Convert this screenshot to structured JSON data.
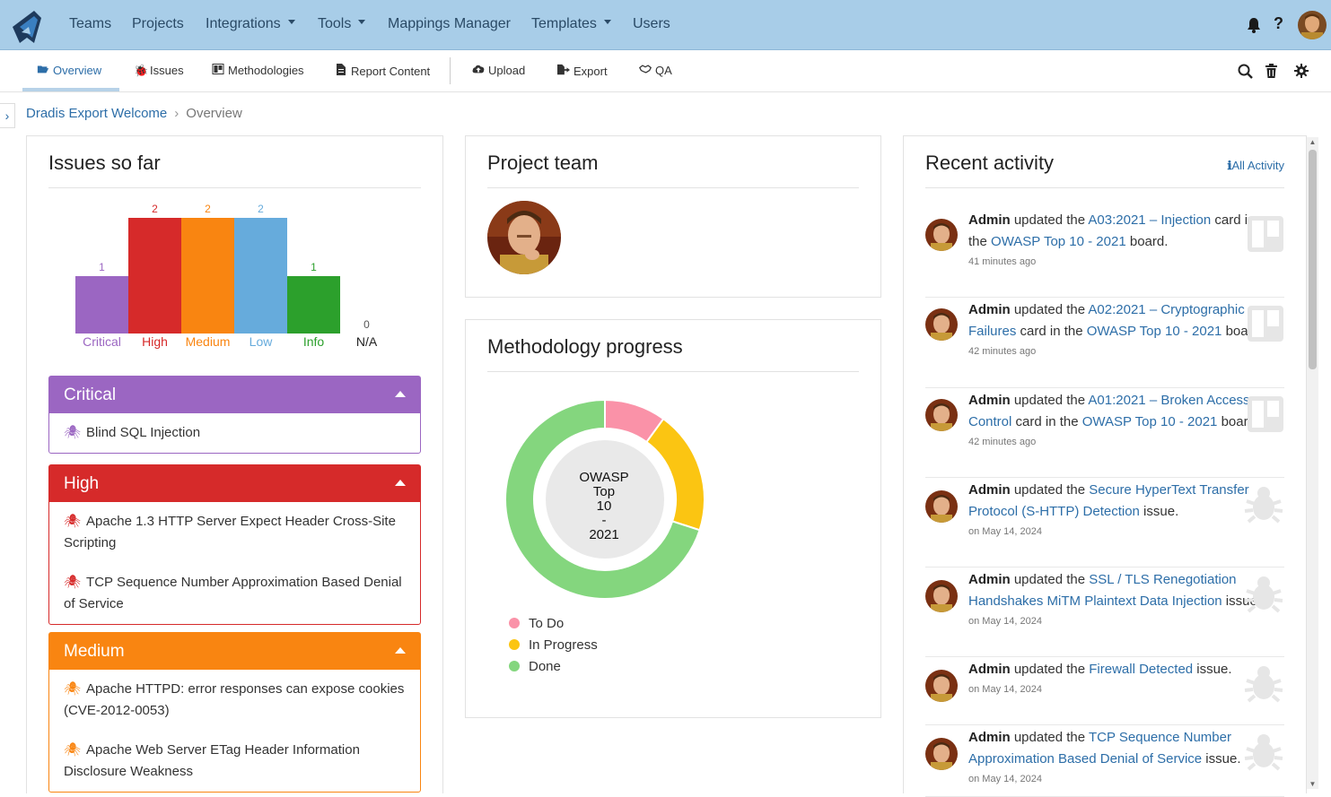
{
  "topnav": {
    "items": [
      {
        "label": "Teams"
      },
      {
        "label": "Projects"
      },
      {
        "label": "Integrations"
      },
      {
        "label": "Tools"
      },
      {
        "label": "Mappings Manager"
      },
      {
        "label": "Templates"
      },
      {
        "label": "Users"
      }
    ],
    "bg_color": "#a8cde8"
  },
  "subnav": {
    "items": [
      {
        "label": "Overview"
      },
      {
        "label": "Issues"
      },
      {
        "label": "Methodologies"
      },
      {
        "label": "Report Content"
      },
      {
        "label": "Upload"
      },
      {
        "label": "Export"
      },
      {
        "label": "QA"
      }
    ]
  },
  "breadcrumb": {
    "project": "Dradis Export Welcome",
    "current": "Overview"
  },
  "issues_card": {
    "title": "Issues so far",
    "groups": [
      {
        "name": "Critical",
        "color": "#9b66c2",
        "issues": [
          "Blind SQL Injection"
        ]
      },
      {
        "name": "High",
        "color": "#d62a2a",
        "issues": [
          "Apache 1.3 HTTP Server Expect Header Cross-Site Scripting",
          "TCP Sequence Number Approximation Based Denial of Service"
        ]
      },
      {
        "name": "Medium",
        "color": "#f98511",
        "issues": [
          "Apache HTTPD: error responses can expose cookies (CVE-2012-0053)",
          "Apache Web Server ETag Header Information Disclosure Weakness"
        ]
      }
    ]
  },
  "chart_data": [
    {
      "type": "bar",
      "categories": [
        "Critical",
        "High",
        "Medium",
        "Low",
        "Info",
        "N/A"
      ],
      "values": [
        1,
        2,
        2,
        2,
        1,
        0
      ],
      "colors": [
        "#9b66c2",
        "#d62a2a",
        "#f98511",
        "#66abdc",
        "#2ca02c",
        "#555555"
      ],
      "title": "",
      "xlabel": "",
      "ylabel": "",
      "ylim": [
        0,
        2
      ]
    },
    {
      "type": "pie",
      "title": "OWASP Top 10 - 2021",
      "categories": [
        "To Do",
        "In Progress",
        "Done"
      ],
      "values": [
        1,
        2,
        7
      ],
      "colors": [
        "#fa92a8",
        "#fbc512",
        "#84d67e"
      ]
    }
  ],
  "team_card": {
    "title": "Project team"
  },
  "methodology_card": {
    "title": "Methodology progress",
    "center_label_lines": [
      "OWASP",
      "Top",
      "10",
      "-",
      "2021"
    ]
  },
  "activity_card": {
    "title": "Recent activity",
    "all_link": "All Activity",
    "items": [
      {
        "user": "Admin",
        "verb": " updated the ",
        "target": "A03:2021 – Injection",
        "mid": " card in the ",
        "board": "OWASP Top 10 - 2021",
        "end": " board.",
        "time": "41 minutes ago",
        "icon": "board-icon"
      },
      {
        "user": "Admin",
        "verb": " updated the ",
        "target": "A02:2021 – Cryptographic Failures",
        "mid": " card in the ",
        "board": "OWASP Top 10 - 2021",
        "end": " board.",
        "time": "42 minutes ago",
        "icon": "board-icon"
      },
      {
        "user": "Admin",
        "verb": " updated the ",
        "target": "A01:2021 – Broken Access Control",
        "mid": " card in the ",
        "board": "OWASP Top 10 - 2021",
        "end": " board.",
        "time": "42 minutes ago",
        "icon": "board-icon"
      },
      {
        "user": "Admin",
        "verb": " updated the ",
        "target": "Secure HyperText Transfer Protocol (S-HTTP) Detection",
        "mid": " issue.",
        "board": "",
        "end": "",
        "time": "on May 14, 2024",
        "icon": "bug-icon"
      },
      {
        "user": "Admin",
        "verb": " updated the ",
        "target": "SSL / TLS Renegotiation Handshakes MiTM Plaintext Data Injection",
        "mid": " issue.",
        "board": "",
        "end": "",
        "time": "on May 14, 2024",
        "icon": "bug-icon"
      },
      {
        "user": "Admin",
        "verb": " updated the ",
        "target": "Firewall Detected",
        "mid": " issue.",
        "board": "",
        "end": "",
        "time": "on May 14, 2024",
        "icon": "bug-icon"
      },
      {
        "user": "Admin",
        "verb": " updated the ",
        "target": "TCP Sequence Number Approximation Based Denial of Service",
        "mid": " issue.",
        "board": "",
        "end": "",
        "time": "on May 14, 2024",
        "icon": "bug-icon"
      }
    ]
  }
}
